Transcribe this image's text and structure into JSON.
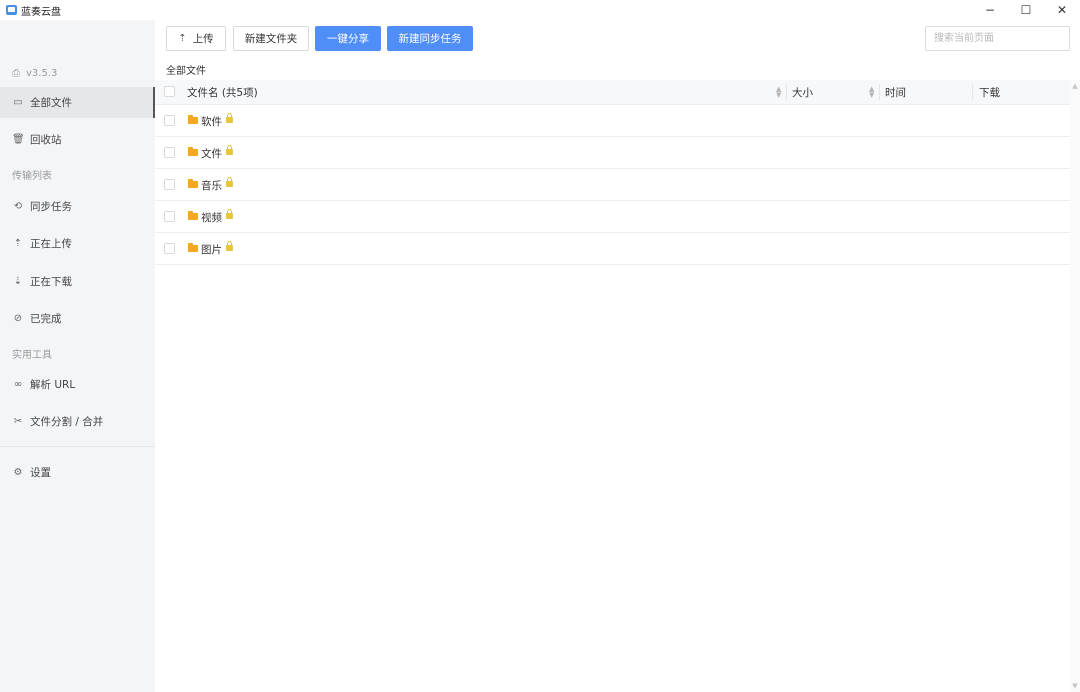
{
  "window": {
    "title": "蓝奏云盘",
    "controls": {
      "minimize": "−",
      "maximize": "☐",
      "close": "✕"
    }
  },
  "sidebar": {
    "version": "v3.5.3",
    "items": [
      {
        "label": "全部文件",
        "icon": "folder-open-icon",
        "active": true
      },
      {
        "label": "回收站",
        "icon": "trash-icon"
      }
    ],
    "transfer_section": "传输列表",
    "transfer_items": [
      {
        "label": "同步任务",
        "icon": "sync-icon"
      },
      {
        "label": "正在上传",
        "icon": "cloud-upload-icon"
      },
      {
        "label": "正在下载",
        "icon": "cloud-download-icon"
      },
      {
        "label": "已完成",
        "icon": "check-circle-icon"
      }
    ],
    "tools_section": "实用工具",
    "tools_items": [
      {
        "label": "解析 URL",
        "icon": "link-icon"
      },
      {
        "label": "文件分割 / 合并",
        "icon": "scissors-icon"
      }
    ],
    "settings": {
      "label": "设置",
      "icon": "gear-icon"
    }
  },
  "toolbar": {
    "upload": "上传",
    "new_folder": "新建文件夹",
    "share": "一键分享",
    "new_sync": "新建同步任务",
    "search_placeholder": "搜索当前页面"
  },
  "breadcrumb": "全部文件",
  "table": {
    "headers": {
      "name": "文件名 (共5项)",
      "size": "大小",
      "time": "时间",
      "download": "下载"
    },
    "rows": [
      {
        "name": "软件",
        "locked": true
      },
      {
        "name": "文件",
        "locked": true
      },
      {
        "name": "音乐",
        "locked": true
      },
      {
        "name": "视频",
        "locked": true
      },
      {
        "name": "图片",
        "locked": true
      }
    ]
  },
  "colors": {
    "primary": "#4f8ef7",
    "folder": "#f5a623",
    "lock": "#e8c63a",
    "sidebar_bg": "#f4f5f7"
  }
}
